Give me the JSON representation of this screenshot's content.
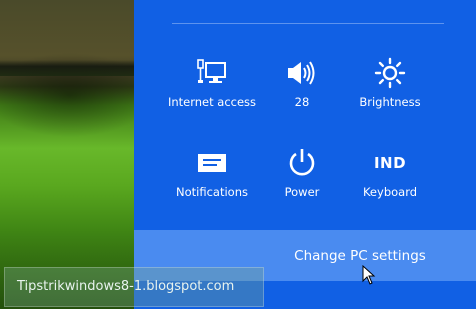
{
  "tiles": {
    "internet_access": "Internet access",
    "volume": "28",
    "brightness": "Brightness",
    "notifications": "Notifications",
    "power": "Power",
    "keyboard": "Keyboard",
    "keyboard_code": "IND"
  },
  "change_pc_settings": "Change PC settings",
  "watermark": "Tipstrikwindows8-1.blogspot.com",
  "colors": {
    "panel": "#1160e4",
    "highlight": "#4a8bf0",
    "text": "#ffffff"
  }
}
